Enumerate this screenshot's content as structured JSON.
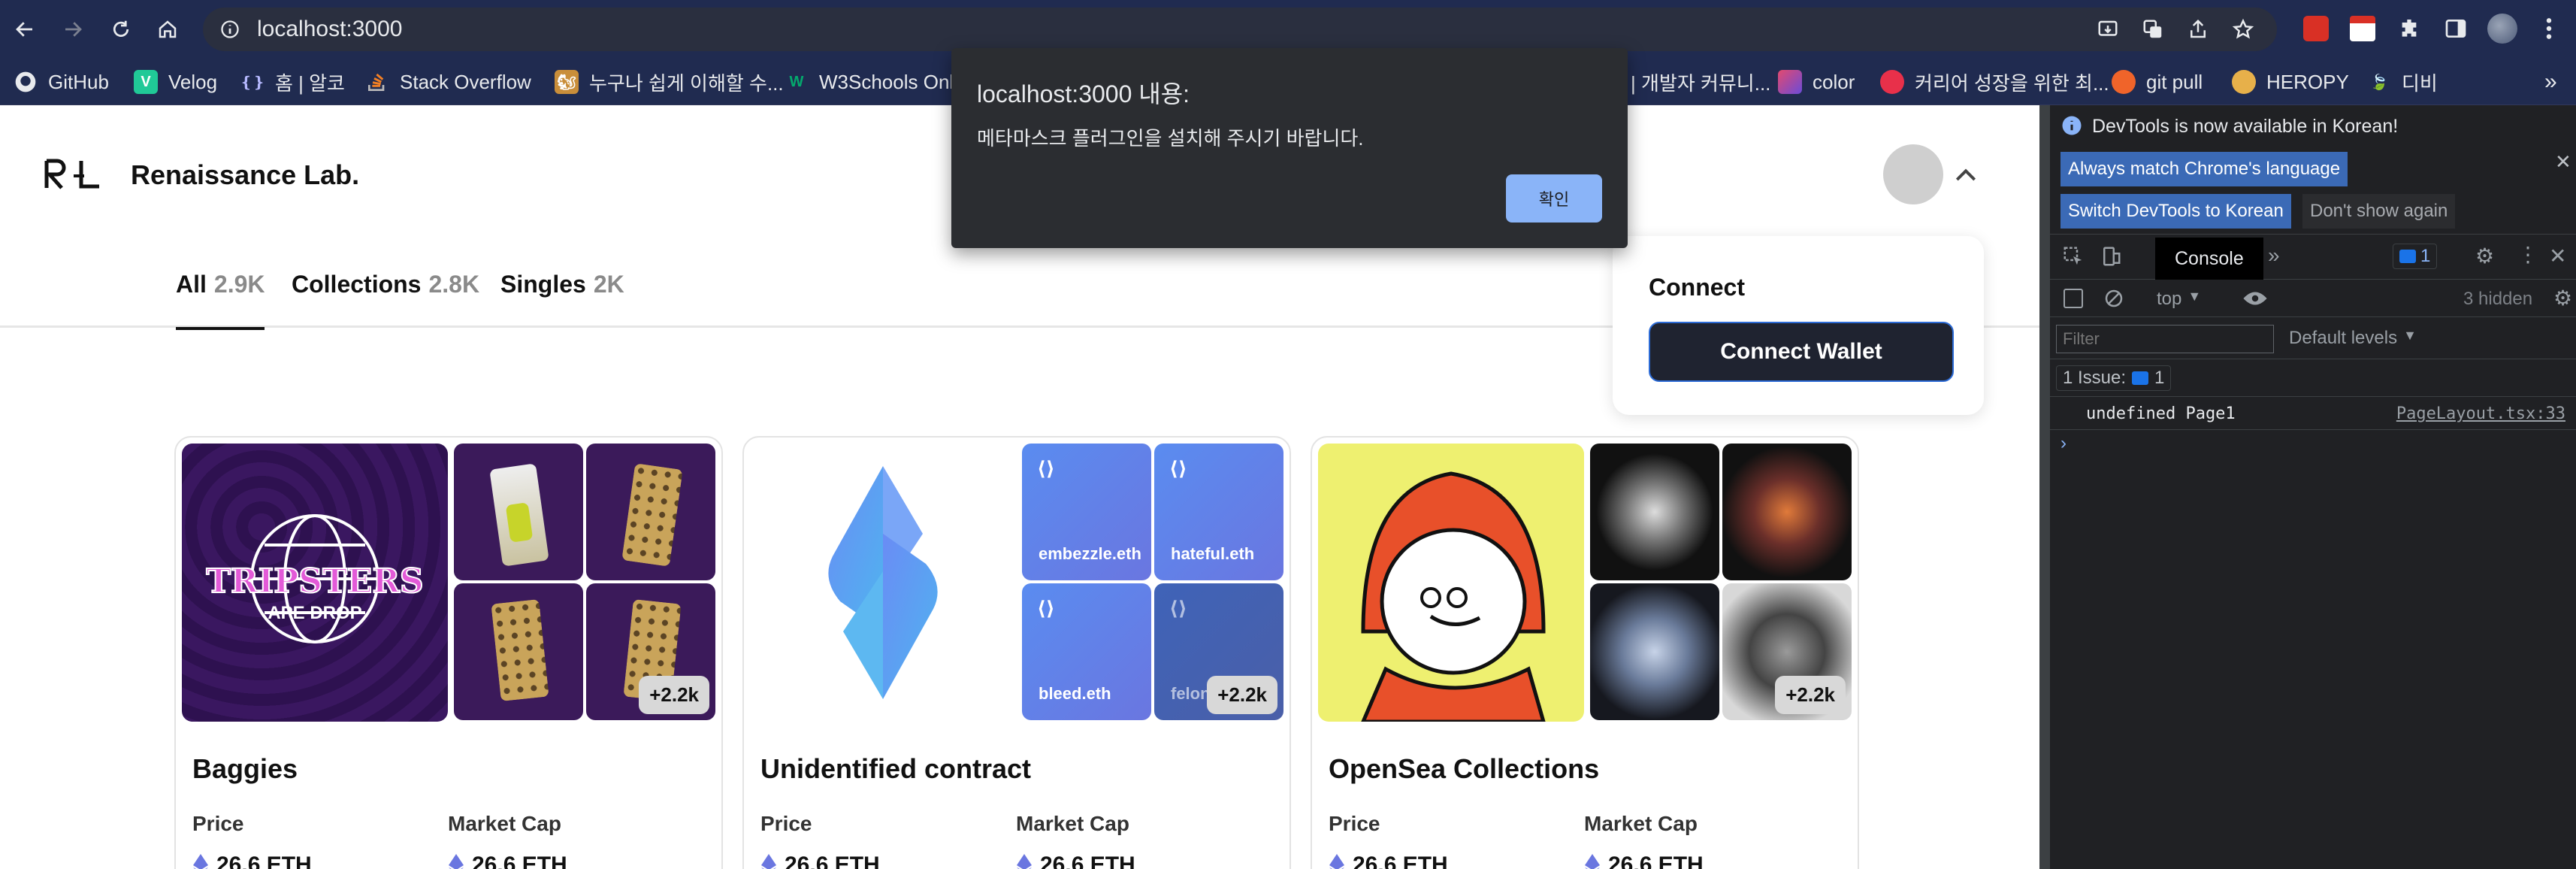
{
  "browser": {
    "url": "localhost:3000",
    "bookmarks": [
      {
        "label": "GitHub",
        "icon": "github-icon"
      },
      {
        "label": "Velog",
        "icon": "velog-icon"
      },
      {
        "label": "홈 | 알코",
        "icon": "code-icon"
      },
      {
        "label": "Stack Overflow",
        "icon": "stackoverflow-icon"
      },
      {
        "label": "누구나 쉽게 이해할 수...",
        "icon": "bookmark-icon"
      },
      {
        "label": "W3Schools Onl",
        "icon": "w3schools-icon"
      },
      {
        "label": "| 개발자 커뮤니...",
        "icon": "bookmark-icon"
      },
      {
        "label": "color",
        "icon": "color-icon"
      },
      {
        "label": "커리어 성장을 위한 최...",
        "icon": "bookmark-icon"
      },
      {
        "label": "git pull",
        "icon": "bookmark-icon"
      },
      {
        "label": "HEROPY",
        "icon": "bookmark-icon"
      },
      {
        "label": "디비",
        "icon": "bookmark-icon"
      }
    ]
  },
  "site": {
    "brand": "Renaissance Lab.",
    "tabs": [
      {
        "label": "All",
        "count": "2.9K"
      },
      {
        "label": "Collections",
        "count": "2.8K"
      },
      {
        "label": "Singles",
        "count": "2K"
      }
    ],
    "dropdown": {
      "title": "Connect",
      "button": "Connect Wallet"
    },
    "cards": [
      {
        "title": "Baggies",
        "more": "+2.2k",
        "price_label": "Price",
        "cap_label": "Market Cap",
        "price": "26.6 ETH",
        "cap": "26.6 ETH",
        "hero_text_1": "TRIPSTERS",
        "hero_text_2": "APE DROP"
      },
      {
        "title": "Unidentified contract",
        "more": "+2.2k",
        "price_label": "Price",
        "cap_label": "Market Cap",
        "price": "26.6 ETH",
        "cap": "26.6 ETH",
        "names": [
          "embezzle.eth",
          "hateful.eth",
          "bleed.eth",
          "felon.e"
        ]
      },
      {
        "title": "OpenSea Collections",
        "more": "+2.2k",
        "price_label": "Price",
        "cap_label": "Market Cap",
        "price": "26.6 ETH",
        "cap": "26.6 ETH"
      }
    ]
  },
  "alert": {
    "title": "localhost:3000 내용:",
    "message": "메타마스크 플러그인을 설치해 주시기 바랍니다.",
    "ok": "확인"
  },
  "devtools": {
    "banner": "DevTools is now available in Korean!",
    "btn_match": "Always match Chrome's language",
    "btn_switch": "Switch DevTools to Korean",
    "btn_dont": "Don't show again",
    "tab_console": "Console",
    "badge": "1",
    "context": "top",
    "hidden": "3 hidden",
    "filter_placeholder": "Filter",
    "levels": "Default levels",
    "issues": "1 Issue:",
    "issues_count": "1",
    "log_text": "undefined Page1",
    "log_source": "PageLayout.tsx:33"
  },
  "colors": {
    "chrome": "#202b50",
    "devtools": "#202124",
    "accent": "#8ab4f8",
    "purple": "#3b1a5a"
  }
}
